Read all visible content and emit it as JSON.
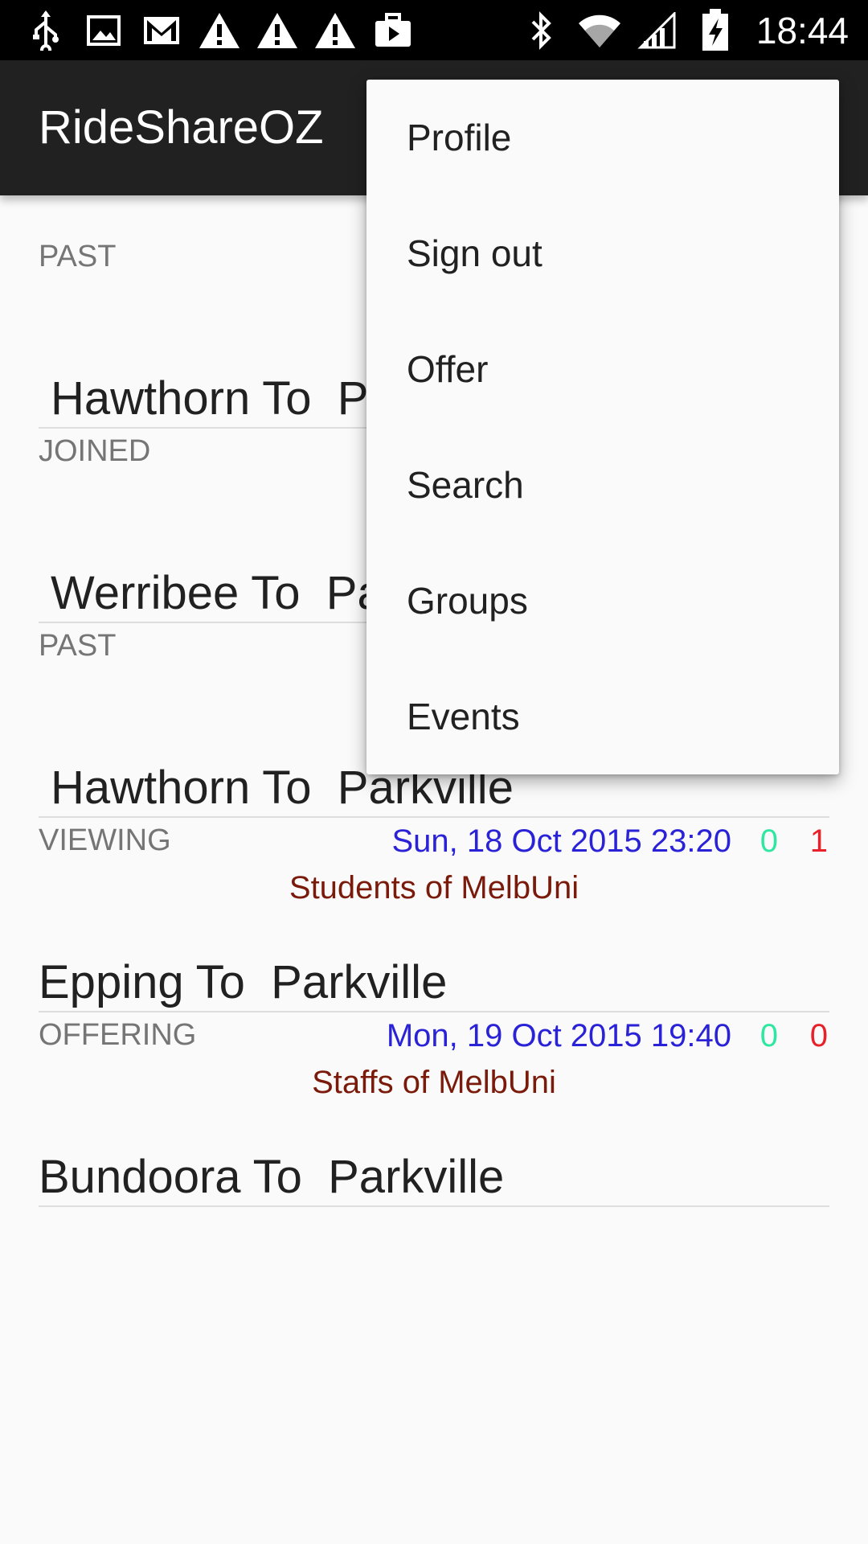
{
  "status_bar": {
    "time": "18:44",
    "left_icons": [
      "usb-icon",
      "image-icon",
      "gmail-icon",
      "warning-icon",
      "warning-icon",
      "warning-icon",
      "briefcase-play-icon"
    ],
    "right_icons": [
      "bluetooth-icon",
      "wifi-icon",
      "signal-icon",
      "battery-charging-icon"
    ]
  },
  "app_bar": {
    "title": "RideShareOZ"
  },
  "rides": [
    {
      "status": "PAST",
      "time": "",
      "green": "",
      "red": "",
      "group": "Stude",
      "route": "Hawthorn To  P"
    },
    {
      "status": "JOINED",
      "time": "",
      "green": "",
      "red": "",
      "group": "Stude",
      "route": "Werribee To  Pa"
    },
    {
      "status": "PAST",
      "time": "",
      "green": "",
      "red": "",
      "group": "Stude",
      "route": "Hawthorn To  Parkville"
    },
    {
      "status": "VIEWING",
      "time": "Sun, 18 Oct 2015 23:20",
      "green": "0",
      "red": "1",
      "group": "Students of MelbUni",
      "route": "Epping To  Parkville"
    },
    {
      "status": "OFFERING",
      "time": "Mon, 19 Oct 2015 19:40",
      "green": "0",
      "red": "0",
      "group": "Staffs of MelbUni",
      "route": "Bundoora To  Parkville"
    }
  ],
  "menu": {
    "items": [
      "Profile",
      "Sign out",
      "Offer",
      "Search",
      "Groups",
      "Events"
    ]
  },
  "colors": {
    "status_bar": "#000000",
    "app_bar": "#212121",
    "time_blue": "#2a22d6",
    "count_green": "#2ee8a2",
    "count_red": "#e8202a",
    "group_brown": "#7a1a0a"
  }
}
